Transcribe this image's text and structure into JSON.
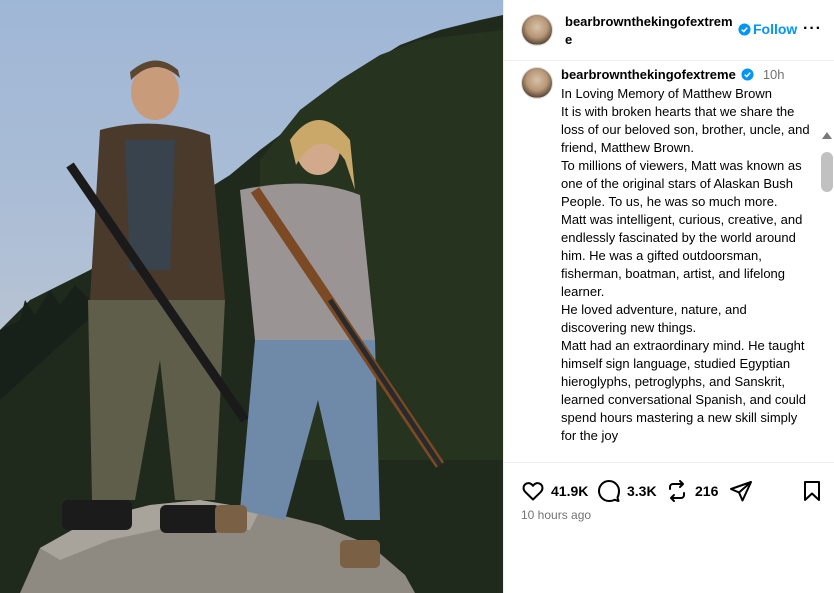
{
  "post": {
    "username": "bearbrownthekingofextreme",
    "follow_label": "Follow",
    "more_label": "···",
    "time_short": "10h",
    "posted_ago": "10 hours ago",
    "caption_lines": [
      "In Loving Memory of Matthew Brown",
      "It is with broken hearts that we share the loss of our beloved son, brother, uncle, and friend, Matthew Brown.",
      "To millions of viewers, Matt was known as one of the original stars of Alaskan Bush People. To us, he was so much more.",
      "Matt was intelligent, curious, creative, and endlessly fascinated by the world around him. He was a gifted outdoorsman, fisherman, boatman, artist, and lifelong learner.",
      "He loved adventure, nature, and discovering new things.",
      "Matt had an extraordinary mind. He taught himself sign language, studied Egyptian hieroglyphs, petroglyphs, and Sanskrit, learned conversational Spanish, and could spend hours mastering a new skill simply for the joy"
    ]
  },
  "stats": {
    "likes": "41.9K",
    "comments": "3.3K",
    "reposts": "216"
  },
  "icons": {
    "verified": "verified-badge-icon",
    "like": "heart-icon",
    "comment": "comment-bubble-icon",
    "repost": "repost-icon",
    "share": "paper-plane-icon",
    "save": "bookmark-icon"
  },
  "colors": {
    "accent": "#0095f6",
    "muted": "#737373"
  }
}
